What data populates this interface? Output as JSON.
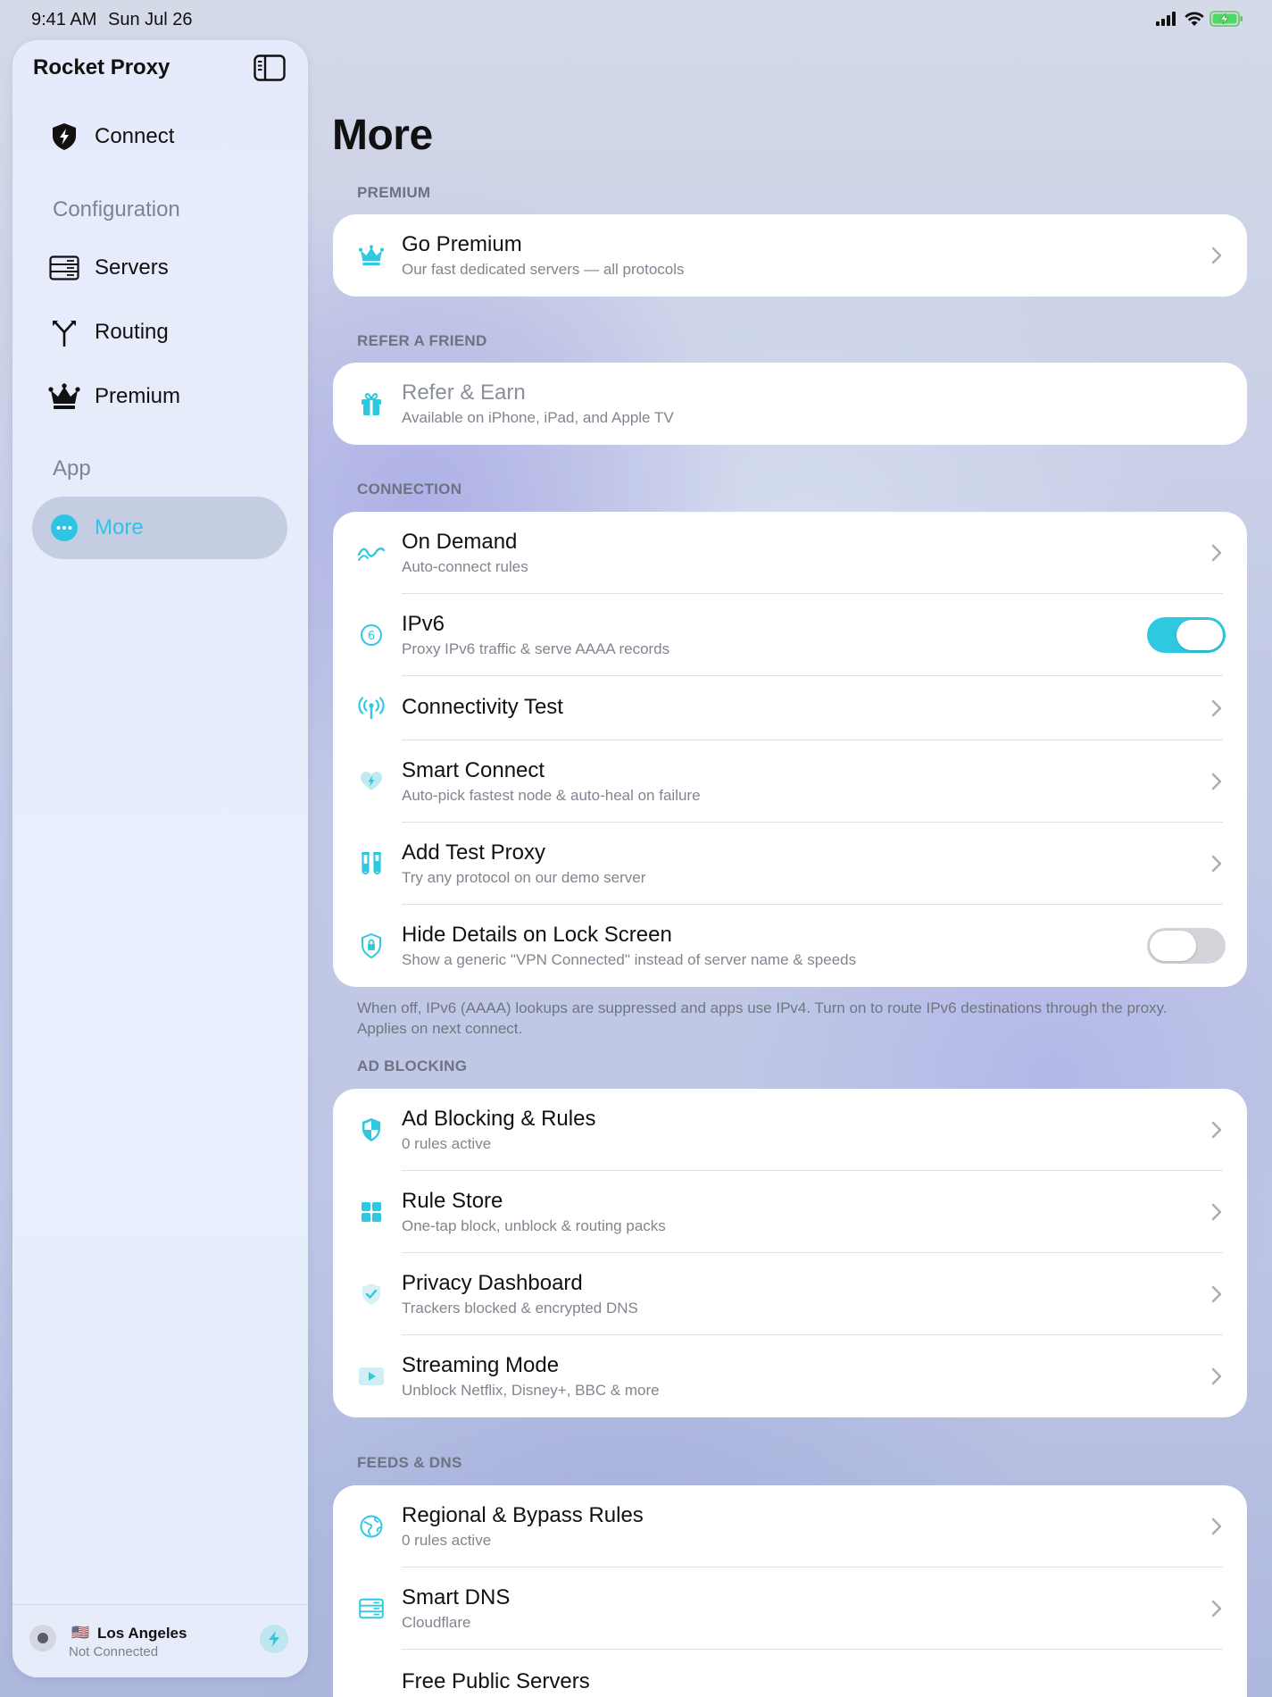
{
  "status_bar": {
    "time": "9:41 AM",
    "date": "Sun Jul 26"
  },
  "colors": {
    "accent": "#2ec9e1",
    "active_nav_bg": "#c5cde2"
  },
  "sidebar": {
    "title": "Rocket Proxy",
    "connect": {
      "label": "Connect",
      "icon": "shield-bolt-icon"
    },
    "section_configuration": "Configuration",
    "servers": {
      "label": "Servers",
      "icon": "server-icon"
    },
    "routing": {
      "label": "Routing",
      "icon": "routing-fork-icon"
    },
    "premium": {
      "label": "Premium",
      "icon": "crown-icon"
    },
    "section_app": "App",
    "more": {
      "label": "More",
      "icon": "ellipsis-circle-icon"
    },
    "footer": {
      "flag": "🇺🇸",
      "city": "Los Angeles",
      "status": "Not Connected"
    }
  },
  "main": {
    "title": "More",
    "sections": {
      "premium": "PREMIUM",
      "refer": "REFER A FRIEND",
      "connection": "CONNECTION",
      "ad_blocking": "AD BLOCKING",
      "feeds_dns": "FEEDS & DNS"
    },
    "go_premium": {
      "title": "Go Premium",
      "subtitle": "Our fast dedicated servers — all protocols"
    },
    "refer_earn": {
      "title": "Refer & Earn",
      "subtitle": "Available on iPhone, iPad, and Apple TV"
    },
    "on_demand": {
      "title": "On Demand",
      "subtitle": "Auto-connect rules"
    },
    "ipv6": {
      "title": "IPv6",
      "subtitle": "Proxy IPv6 traffic & serve AAAA records",
      "enabled": true
    },
    "connectivity_test": {
      "title": "Connectivity Test"
    },
    "smart_connect": {
      "title": "Smart Connect",
      "subtitle": "Auto-pick fastest node & auto-heal on failure"
    },
    "add_test_proxy": {
      "title": "Add Test Proxy",
      "subtitle": "Try any protocol on our demo server"
    },
    "hide_details": {
      "title": "Hide Details on Lock Screen",
      "subtitle": "Show a generic \"VPN Connected\" instead of server name & speeds",
      "enabled": false
    },
    "connection_footnote": "When off, IPv6 (AAAA) lookups are suppressed and apps use IPv4. Turn on to route IPv6 destinations through the proxy. Applies on next connect.",
    "ad_blocking_rules": {
      "title": "Ad Blocking & Rules",
      "subtitle": "0 rules active"
    },
    "rule_store": {
      "title": "Rule Store",
      "subtitle": "One-tap block, unblock & routing packs"
    },
    "privacy_dashboard": {
      "title": "Privacy Dashboard",
      "subtitle": "Trackers blocked & encrypted DNS"
    },
    "streaming_mode": {
      "title": "Streaming Mode",
      "subtitle": "Unblock Netflix, Disney+, BBC & more"
    },
    "regional_bypass": {
      "title": "Regional & Bypass Rules",
      "subtitle": "0 rules active"
    },
    "smart_dns": {
      "title": "Smart DNS",
      "subtitle": "Cloudflare"
    },
    "free_public_servers": {
      "title": "Free Public Servers"
    }
  }
}
